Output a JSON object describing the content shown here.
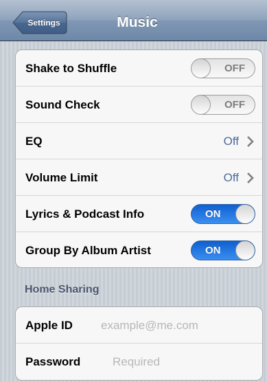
{
  "navbar": {
    "back_label": "Settings",
    "title": "Music"
  },
  "settings": {
    "rows": [
      {
        "label": "Shake to Shuffle",
        "control": "switch",
        "state_text": "OFF",
        "on": false
      },
      {
        "label": "Sound Check",
        "control": "switch",
        "state_text": "OFF",
        "on": false
      },
      {
        "label": "EQ",
        "control": "disclosure",
        "value": "Off"
      },
      {
        "label": "Volume Limit",
        "control": "disclosure",
        "value": "Off"
      },
      {
        "label": "Lyrics & Podcast Info",
        "control": "switch",
        "state_text": "ON",
        "on": true
      },
      {
        "label": "Group By Album Artist",
        "control": "switch",
        "state_text": "ON",
        "on": true
      }
    ]
  },
  "home_sharing": {
    "header": "Home Sharing",
    "apple_id": {
      "label": "Apple ID",
      "value": "",
      "placeholder": "example@me.com"
    },
    "password": {
      "label": "Password",
      "value": "",
      "placeholder": "Required"
    }
  },
  "colors": {
    "switch_on": "#1f6fe0",
    "value_text": "#4d6c98",
    "navbar": "#8fa4bd"
  },
  "icons": [
    "back-arrow-icon",
    "chevron-right-icon",
    "switch-knob-icon"
  ]
}
